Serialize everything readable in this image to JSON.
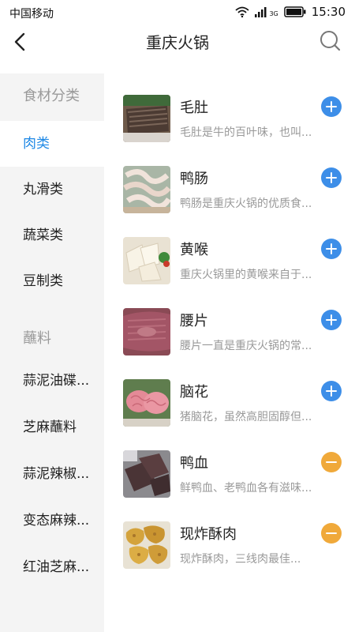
{
  "status_bar": {
    "carrier": "中国移动",
    "network": "3G",
    "time": "15:30"
  },
  "header": {
    "title": "重庆火锅",
    "back_icon": "back-arrow-icon",
    "search_icon": "search-icon"
  },
  "sidebar": {
    "sections": [
      {
        "title": "食材分类",
        "items": [
          {
            "label": "肉类",
            "active": true
          },
          {
            "label": "丸滑类",
            "active": false
          },
          {
            "label": "蔬菜类",
            "active": false
          },
          {
            "label": "豆制类",
            "active": false
          }
        ]
      },
      {
        "title": "蘸料",
        "items": [
          {
            "label": "蒜泥油碟...",
            "active": false
          },
          {
            "label": "芝麻蘸料",
            "active": false
          },
          {
            "label": "蒜泥辣椒...",
            "active": false
          },
          {
            "label": "变态麻辣...",
            "active": false
          },
          {
            "label": "红油芝麻...",
            "active": false
          }
        ]
      }
    ]
  },
  "items": [
    {
      "name": "毛肚",
      "desc": "毛肚是牛的百叶味，也叫...",
      "action": "add",
      "icon": "tripe-photo"
    },
    {
      "name": "鸭肠",
      "desc": "鸭肠是重庆火锅的优质食...",
      "action": "add",
      "icon": "duck-intestine-photo"
    },
    {
      "name": "黄喉",
      "desc": "重庆火锅里的黄喉来自于...",
      "action": "add",
      "icon": "aorta-photo"
    },
    {
      "name": "腰片",
      "desc": "腰片一直是重庆火锅的常...",
      "action": "add",
      "icon": "kidney-slice-photo"
    },
    {
      "name": "脑花",
      "desc": "猪脑花，虽然高胆固醇但...",
      "action": "add",
      "icon": "pig-brain-photo"
    },
    {
      "name": "鸭血",
      "desc": "鲜鸭血、老鸭血各有滋味...",
      "action": "remove",
      "icon": "duck-blood-photo"
    },
    {
      "name": "现炸酥肉",
      "desc": "现炸酥肉，三线肉最佳...",
      "action": "remove",
      "icon": "fried-pork-photo"
    }
  ],
  "colors": {
    "accent": "#1e88e5",
    "add_button": "#3d8ee8",
    "remove_button": "#f0a93a",
    "sidebar_bg": "#f4f4f4"
  }
}
